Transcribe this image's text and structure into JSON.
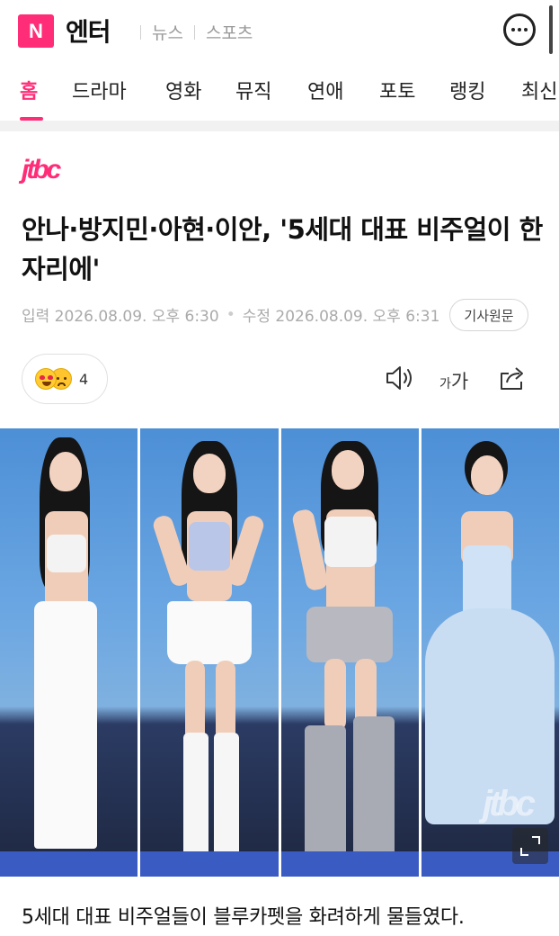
{
  "header": {
    "logo_letter": "N",
    "brand": "엔터",
    "links": [
      "뉴스",
      "스포츠"
    ]
  },
  "nav": {
    "tabs": [
      "홈",
      "드라마",
      "영화",
      "뮤직",
      "연애",
      "포토",
      "랭킹",
      "최신"
    ],
    "active": "홈"
  },
  "article": {
    "press": "jtbc",
    "headline": "안나·방지민·아현·이안, '5세대 대표 비주얼이 한 자리에'",
    "published": "입력 2026.08.09. 오후 6:30",
    "modified": "수정 2026.08.09. 오후 6:31",
    "source_button": "기사원문",
    "reaction_count": "4",
    "font_small": "가",
    "font_big": "가",
    "photo_watermark": "jtbc",
    "caption": "5세대 대표 비주얼들이 블루카펫을 화려하게 물들였다."
  },
  "colors": {
    "accent": "#ff2d78",
    "stage_blue": "#4d8fd6",
    "carpet_blue": "#3a5bc2"
  },
  "icons": [
    "chat-icon",
    "speaker-icon",
    "share-icon",
    "expand-icon"
  ]
}
